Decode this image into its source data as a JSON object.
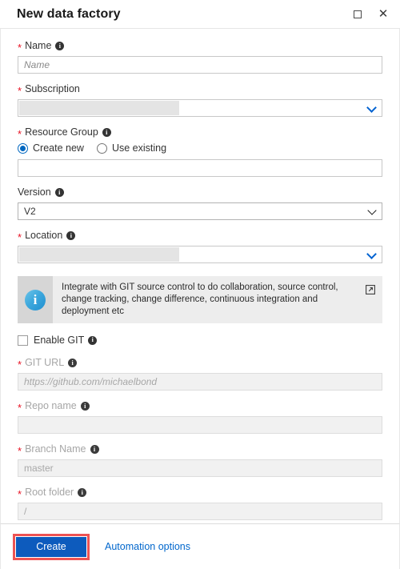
{
  "window": {
    "title": "New data factory",
    "maximize_icon": "maximize-icon",
    "close_icon": "close-icon",
    "close_glyph": "✕"
  },
  "form": {
    "name": {
      "label": "Name",
      "required_mark": "*",
      "info_glyph": "i",
      "placeholder": "Name",
      "value": ""
    },
    "subscription": {
      "label": "Subscription",
      "required_mark": "*",
      "value": "",
      "masked": true,
      "chevron": "chevron-down-icon"
    },
    "resource_group": {
      "label": "Resource Group",
      "required_mark": "*",
      "info_glyph": "i",
      "options": [
        {
          "label": "Create new",
          "selected": true
        },
        {
          "label": "Use existing",
          "selected": false
        }
      ],
      "input_value": "",
      "input_placeholder": ""
    },
    "version": {
      "label": "Version",
      "required_mark": "",
      "info_glyph": "i",
      "value": "V2",
      "chevron": "chevron-down-icon"
    },
    "location": {
      "label": "Location",
      "required_mark": "*",
      "info_glyph": "i",
      "value": "",
      "masked": true,
      "chevron": "chevron-down-icon"
    },
    "git_banner": {
      "icon": "info-icon",
      "icon_glyph": "i",
      "text": "Integrate with GIT source control to do collaboration, source control, change tracking, change difference, continuous integration and deployment etc",
      "external_link_icon": "external-link-icon"
    },
    "enable_git": {
      "label": "Enable GIT",
      "checked": false,
      "info_glyph": "i"
    },
    "git_url": {
      "label": "GIT URL",
      "required_mark": "*",
      "info_glyph": "i",
      "placeholder": "https://github.com/michaelbond",
      "value": "",
      "disabled": true
    },
    "repo_name": {
      "label": "Repo name",
      "required_mark": "*",
      "info_glyph": "i",
      "placeholder": "",
      "value": "",
      "disabled": true
    },
    "branch_name": {
      "label": "Branch Name",
      "required_mark": "*",
      "info_glyph": "i",
      "placeholder": "master",
      "value": "",
      "disabled": true
    },
    "root_folder": {
      "label": "Root folder",
      "required_mark": "*",
      "info_glyph": "i",
      "placeholder": "/",
      "value": "",
      "disabled": true
    }
  },
  "footer": {
    "create_label": "Create",
    "automation_label": "Automation options"
  },
  "colors": {
    "accent_blue": "#0d5bbd",
    "link_blue": "#0066cc",
    "required_red": "#e81123",
    "annotation_red": "#ee5353",
    "radio_blue": "#0067c0",
    "banner_bg": "#ededed",
    "banner_icon_bg": "#d6d6d6",
    "disabled_field_bg": "#f1f1f1",
    "mask_grey": "#e4e4e4"
  }
}
